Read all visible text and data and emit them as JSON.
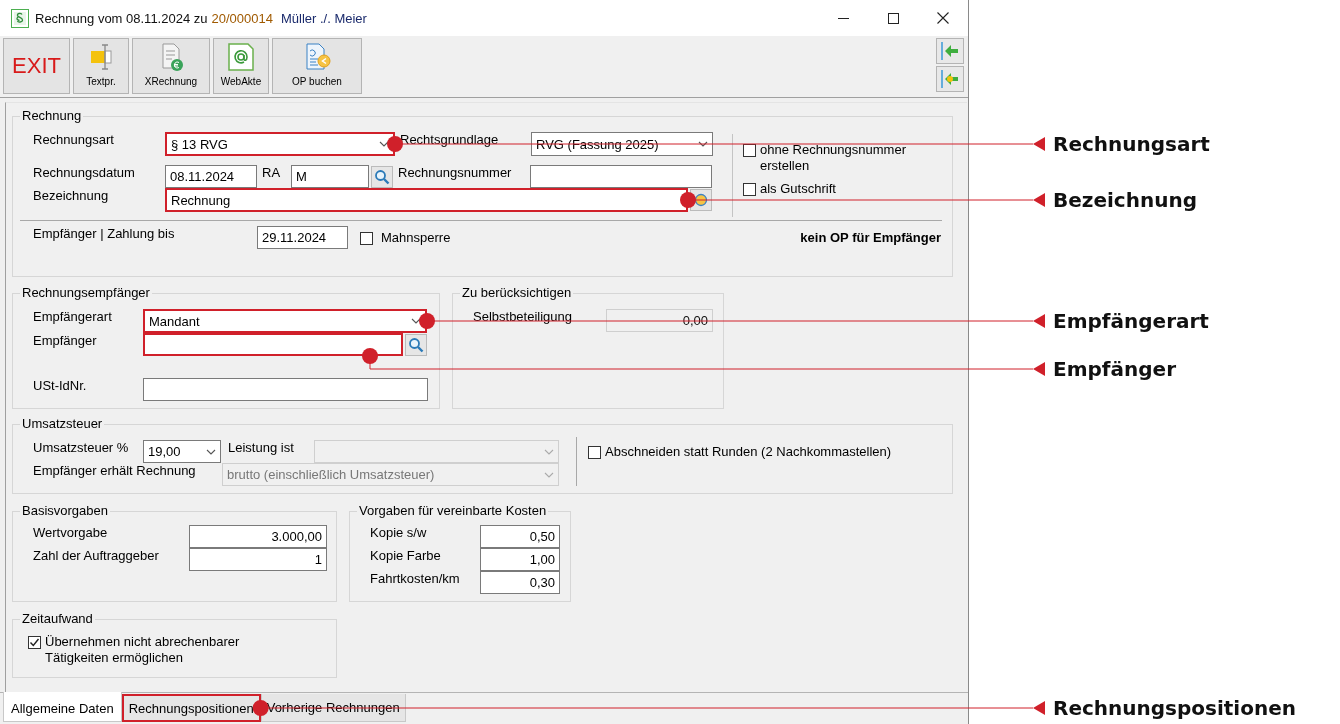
{
  "window": {
    "title": "Rechnung vom 08.11.2024 zu",
    "invoice_number": "20/000014",
    "parties": "Müller ./. Meier"
  },
  "toolbar": {
    "buttons": [
      {
        "label": "EXIT",
        "kind": "exit"
      },
      {
        "label": "Textpr.",
        "kind": "text"
      },
      {
        "label": "XRechnung",
        "kind": "xrechnung"
      },
      {
        "label": "WebAkte",
        "kind": "webakte"
      },
      {
        "label": "OP buchen",
        "kind": "op"
      }
    ]
  },
  "rechnung": {
    "legend": "Rechnung",
    "rechnungsart": {
      "label": "Rechnungsart",
      "value": "§ 13 RVG",
      "callout": {
        "label": "Rechnungsart",
        "kind": "side"
      }
    },
    "rechtsgrundlage": {
      "label": "Rechtsgrundlage",
      "value": "RVG (Fassung 2025)"
    },
    "rechnungsdatum": {
      "label": "Rechnungsdatum",
      "value": "08.11.2024"
    },
    "ra": {
      "label": "RA",
      "value": "M"
    },
    "rechnungsnummer": {
      "label": "Rechnungsnummer"
    },
    "bezeichnung": {
      "label": "Bezeichnung",
      "value": "Rechnung",
      "callout": {
        "label": "Bezeichnung",
        "kind": "side"
      }
    },
    "options": [
      {
        "label": "ohne Rechnungsnummer erstellen",
        "checked": false
      },
      {
        "label": "als Gutschrift",
        "checked": false
      }
    ],
    "zahlung": {
      "label": "Empfänger | Zahlung bis",
      "value": "29.11.2024"
    },
    "mahnsperre": {
      "label": "Mahnsperre",
      "checked": false
    },
    "op_note": "kein OP für Empfänger"
  },
  "rechnungsempfaenger": {
    "legend": "Rechnungsempfänger",
    "empfaengerart": {
      "label": "Empfängerart",
      "value": "Mandant",
      "callout": {
        "label": "Empfängerart",
        "kind": "side"
      }
    },
    "empfaenger": {
      "label": "Empfänger",
      "callout": {
        "label": "Empfänger",
        "kind": "below"
      }
    },
    "ust_id": {
      "label": "USt-IdNr."
    }
  },
  "zu_beruecksichtigen": {
    "legend": "Zu berücksichtigen",
    "selbstbeteiligung": {
      "label": "Selbstbeteiligung",
      "value": "0,00",
      "readonly": true
    }
  },
  "umsatzsteuer": {
    "legend": "Umsatzsteuer",
    "satz": {
      "label": "Umsatzsteuer %",
      "value": "19,00"
    },
    "leistung": {
      "label": "Leistung ist",
      "disabled": true
    },
    "rechnung": {
      "label": "Empfänger erhält Rechnung",
      "value": "brutto (einschließlich Umsatzsteuer)",
      "disabled": true
    },
    "abschneiden": {
      "label": "Abschneiden statt Runden (2 Nachkommastellen)",
      "checked": false
    }
  },
  "basisvorgaben": {
    "legend": "Basisvorgaben",
    "fields": [
      {
        "label": "Wertvorgabe",
        "value": "3.000,00"
      },
      {
        "label": "Zahl der Auftraggeber",
        "value": "1"
      }
    ]
  },
  "kosten": {
    "legend": "Vorgaben für vereinbarte Kosten",
    "fields": [
      {
        "label": "Kopie s/w",
        "value": "0,50"
      },
      {
        "label": "Kopie Farbe",
        "value": "1,00"
      },
      {
        "label": "Fahrtkosten/km",
        "value": "0,30"
      }
    ]
  },
  "zeitaufwand": {
    "legend": "Zeitaufwand",
    "option": {
      "label": "Übernehmen nicht abrechenbarer Tätigkeiten ermöglichen",
      "checked": true
    }
  },
  "tabs": [
    {
      "label": "Allgemeine Daten",
      "selected": true
    },
    {
      "label": "Rechnungspositionen",
      "selected": false,
      "callout": {
        "label": "Rechnungspositionen",
        "kind": "side"
      }
    },
    {
      "label": "Vorherige Rechnungen",
      "selected": false
    }
  ]
}
